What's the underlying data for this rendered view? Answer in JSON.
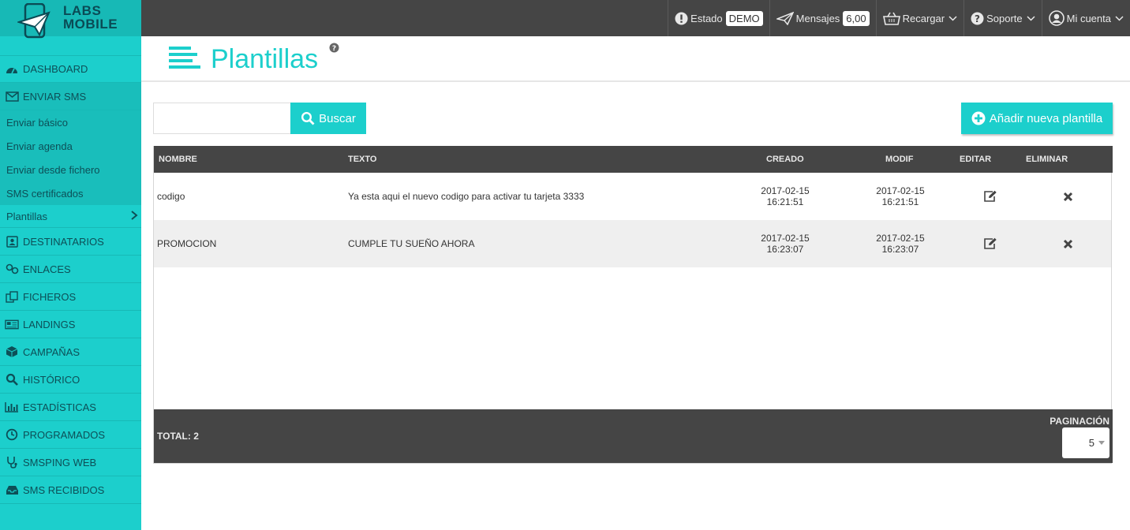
{
  "brand": {
    "line1": "LABS",
    "line2": "MOBILE"
  },
  "colors": {
    "accent": "#1ccfcc",
    "accent_dark": "#17b9b6",
    "topbar": "#454545",
    "menu_text": "#0d4f57"
  },
  "topbar": {
    "estado_label": "Estado",
    "estado_value": "DEMO",
    "mensajes_label": "Mensajes",
    "mensajes_value": "6,00",
    "recargar_label": "Recargar",
    "soporte_label": "Soporte",
    "cuenta_label": "Mi cuenta"
  },
  "sidebar": {
    "items": [
      {
        "label": "DASHBOARD",
        "icon": "dashboard-icon"
      },
      {
        "label": "ENVIAR SMS",
        "icon": "envelope-icon"
      },
      {
        "label": "DESTINATARIOS",
        "icon": "contacts-icon"
      },
      {
        "label": "ENLACES",
        "icon": "link-icon"
      },
      {
        "label": "FICHEROS",
        "icon": "files-icon"
      },
      {
        "label": "LANDINGS",
        "icon": "newspaper-icon"
      },
      {
        "label": "CAMPAÑAS",
        "icon": "cube-icon"
      },
      {
        "label": "HISTÓRICO",
        "icon": "search-icon"
      },
      {
        "label": "ESTADÍSTICAS",
        "icon": "bar-chart-icon"
      },
      {
        "label": "PROGRAMADOS",
        "icon": "clock-icon"
      },
      {
        "label": "SMSPING WEB",
        "icon": "stethoscope-icon"
      },
      {
        "label": "SMS RECIBIDOS",
        "icon": "inbox-icon"
      }
    ],
    "submenu": [
      "Enviar básico",
      "Enviar agenda",
      "Enviar desde fichero",
      "SMS certificados",
      "Plantillas"
    ]
  },
  "page": {
    "title": "Plantillas"
  },
  "search": {
    "placeholder": "",
    "button_label": "Buscar"
  },
  "add_button_label": "Añadir nueva plantilla",
  "table": {
    "headers": {
      "nombre": "NOMBRE",
      "texto": "TEXTO",
      "creado": "CREADO",
      "modif": "MODIF",
      "editar": "EDITAR",
      "eliminar": "ELIMINAR"
    },
    "rows": [
      {
        "nombre": "codigo",
        "texto": "Ya esta aqui el nuevo codigo para activar tu tarjeta 3333",
        "creado_date": "2017-02-15",
        "creado_time": "16:21:51",
        "modif_date": "2017-02-15",
        "modif_time": "16:21:51"
      },
      {
        "nombre": "PROMOCION",
        "texto": "CUMPLE TU SUEÑO AHORA",
        "creado_date": "2017-02-15",
        "creado_time": "16:23:07",
        "modif_date": "2017-02-15",
        "modif_time": "16:23:07"
      }
    ],
    "total_label": "TOTAL: 2",
    "pagination_label": "PAGINACIÓN",
    "pagination_value": "5"
  }
}
